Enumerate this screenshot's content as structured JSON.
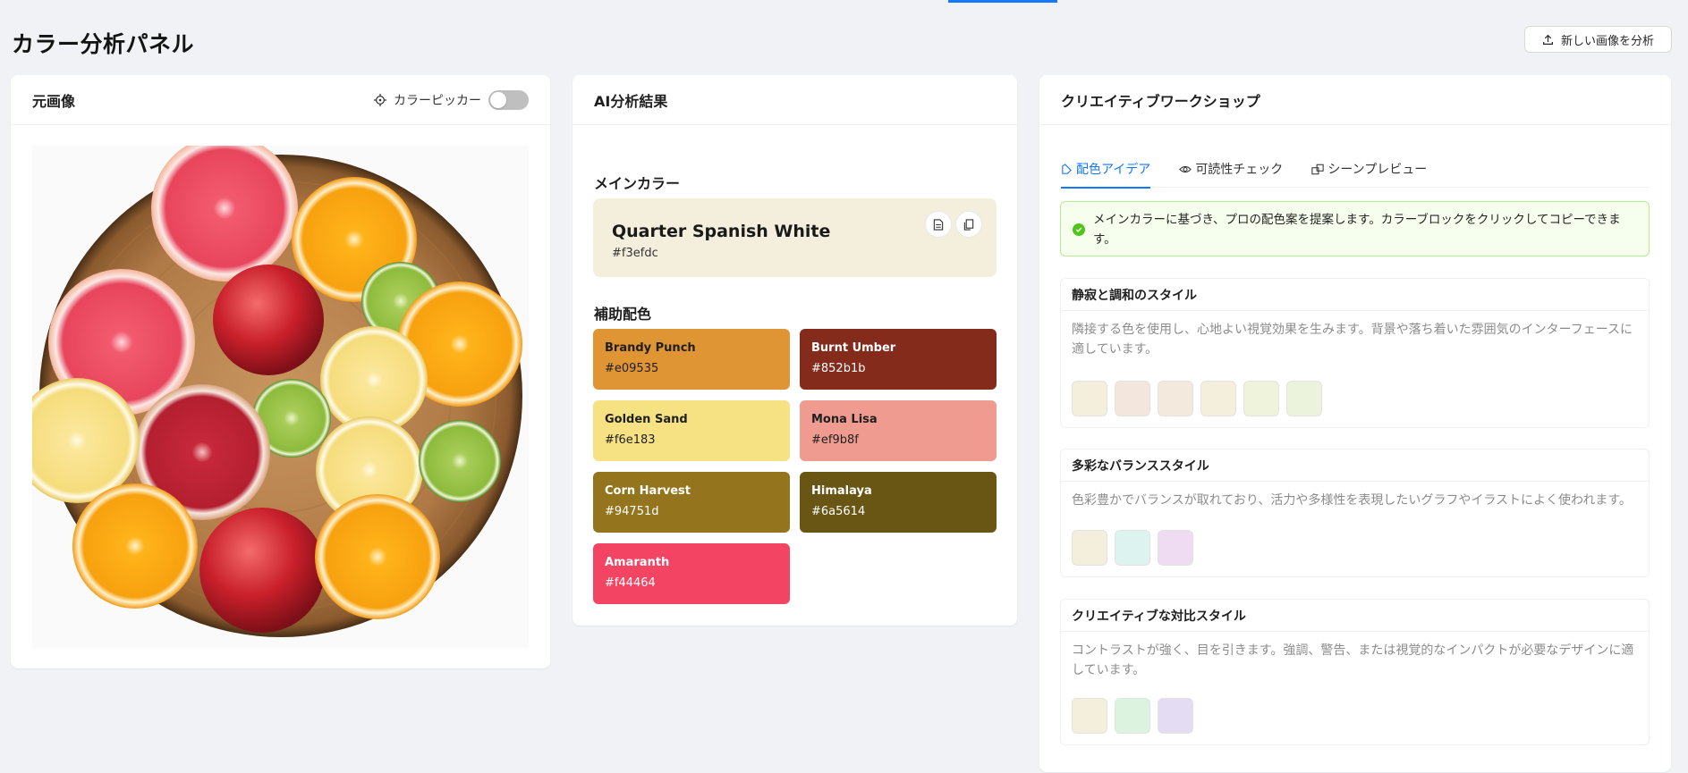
{
  "header": {
    "title": "カラー分析パネル",
    "analyze_button_label": "新しい画像を分析"
  },
  "image_panel": {
    "title": "元画像",
    "color_picker_label": "カラーピッカー",
    "color_picker_enabled": false
  },
  "ai_panel": {
    "title": "AI分析結果",
    "main_color_heading": "メインカラー",
    "main_color": {
      "name": "Quarter Spanish White",
      "hex": "#f3efdc"
    },
    "secondary_heading": "補助配色",
    "secondary_colors": [
      {
        "name": "Brandy Punch",
        "hex": "#e09535",
        "text_color": "#1f1f1f"
      },
      {
        "name": "Burnt Umber",
        "hex": "#852b1b",
        "text_color": "#ffffff"
      },
      {
        "name": "Golden Sand",
        "hex": "#f6e183",
        "text_color": "#1f1f1f"
      },
      {
        "name": "Mona Lisa",
        "hex": "#ef9b8f",
        "text_color": "#1f1f1f"
      },
      {
        "name": "Corn Harvest",
        "hex": "#94751d",
        "text_color": "#ffffff"
      },
      {
        "name": "Himalaya",
        "hex": "#6a5614",
        "text_color": "#ffffff"
      },
      {
        "name": "Amaranth",
        "hex": "#f44464",
        "text_color": "#ffffff"
      }
    ]
  },
  "workshop_panel": {
    "title": "クリエイティブワークショップ",
    "tabs": [
      {
        "label": "配色アイデア",
        "icon": "palette-icon",
        "active": true
      },
      {
        "label": "可読性チェック",
        "icon": "eye-icon",
        "active": false
      },
      {
        "label": "シーンプレビュー",
        "icon": "scene-icon",
        "active": false
      }
    ],
    "info_message": "メインカラーに基づき、プロの配色案を提案します。カラーブロックをクリックしてコピーできます。",
    "styles": [
      {
        "title": "静寂と調和のスタイル",
        "description": "隣接する色を使用し、心地よい視覚効果を生みます。背景や落ち着いた雰囲気のインターフェースに適しています。",
        "colors": [
          "#f3efdc",
          "#f3e6dc",
          "#f3e9dc",
          "#f3efdc",
          "#f0f3dc",
          "#ebf3dc"
        ]
      },
      {
        "title": "多彩なバランススタイル",
        "description": "色彩豊かでバランスが取れており、活力や多様性を表現したいグラフやイラストによく使われます。",
        "colors": [
          "#f3efdc",
          "#dcf3ef",
          "#efdcf3"
        ]
      },
      {
        "title": "クリエイティブな対比スタイル",
        "description": "コントラストが強く、目を引きます。強調、警告、または視覚的なインパクトが必要なデザインに適しています。",
        "colors": [
          "#f3efdc",
          "#dcf3e0",
          "#e3dcf3"
        ]
      }
    ]
  }
}
